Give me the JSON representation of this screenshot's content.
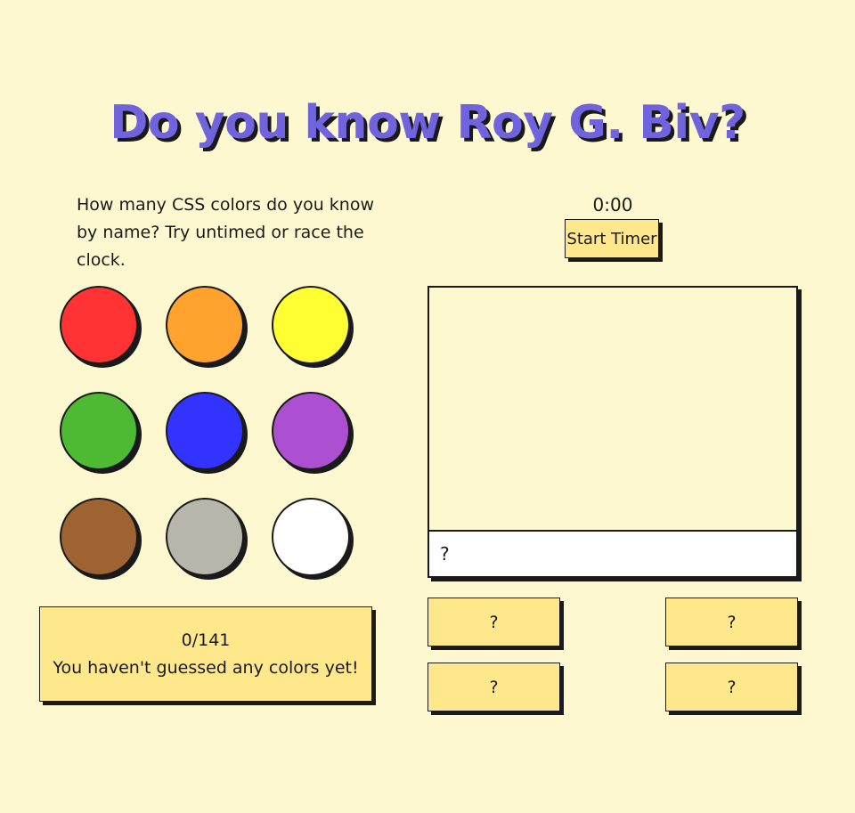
{
  "title": "Do you know Roy G. Biv?",
  "intro": "How many CSS colors do you know by name? Try untimed or race the clock.",
  "timer": {
    "display": "0:00",
    "start_label": "Start Timer"
  },
  "swatches": [
    {
      "name": "red",
      "color": "#ff3333"
    },
    {
      "name": "orange",
      "color": "#ffa22e"
    },
    {
      "name": "yellow",
      "color": "#ffff33"
    },
    {
      "name": "green",
      "color": "#4eb933"
    },
    {
      "name": "blue",
      "color": "#3333ff"
    },
    {
      "name": "purple",
      "color": "#ac50d1"
    },
    {
      "name": "brown",
      "color": "#9f6332"
    },
    {
      "name": "gray",
      "color": "#b6b6aa"
    },
    {
      "name": "white",
      "color": "#ffffff"
    }
  ],
  "score": {
    "count": "0/141",
    "message": "You haven't guessed any colors yet!"
  },
  "guess": {
    "placeholder": "?"
  },
  "options": [
    "?",
    "?",
    "?",
    "?"
  ],
  "colors": {
    "background": "#fef8d0",
    "accent": "#7063de",
    "button": "#ffe88c",
    "ink": "#1a1a1a"
  }
}
